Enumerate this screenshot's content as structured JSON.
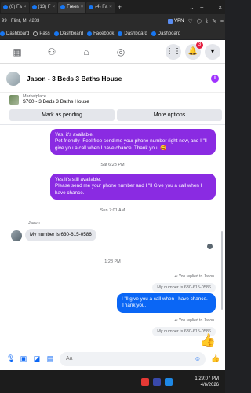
{
  "browser": {
    "tabs": [
      {
        "label": "(8) Fa",
        "active": false
      },
      {
        "label": "(13) F",
        "active": false
      },
      {
        "label": "Freen",
        "active": true
      },
      {
        "label": "(4) Fa",
        "active": false
      }
    ],
    "page_title": "99 · Flint, MI #283",
    "vpn_label": "VPN",
    "bookmarks": [
      "Dashboard",
      "Pass",
      "Dashboard",
      "Facebook",
      "Dashboard",
      "Dashboard"
    ]
  },
  "fb": {
    "notification_count": "3"
  },
  "chat": {
    "title": "Jason - 3 Beds 3 Baths House",
    "marketplace_label": "Marketplace",
    "listing": "$760 - 3 Beds 3 Baths House",
    "mark_pending": "Mark as pending",
    "more_options": "More options"
  },
  "messages": {
    "m1": "Yes, it's available,\nPet friendly- Feel free send me your phone number right now, and I \"ll give you a call when I have chance. Thank you. 🥰",
    "ts1": "Sat 6:23 PM",
    "m2": "Yes,It's still available.\nPlease send me your phone number and I \"ll Give you a call when I have chance.",
    "ts2": "Sun 7:01 AM",
    "sender": "Jason",
    "m3": "My number is 630-615-0586",
    "ts3": "1:28 PM",
    "reply_note": "You replied to Jason",
    "quoted": "My number is 630-615-0586",
    "m4": "I \"ll give you a call when I have chance. Thank you.",
    "reply_note2": "You replied to Jason",
    "quoted2": "My number is 630-615-0586"
  },
  "composer": {
    "placeholder": "Aa"
  },
  "taskbar": {
    "time": "1:29:07 PM",
    "date": "4/6/2026"
  }
}
